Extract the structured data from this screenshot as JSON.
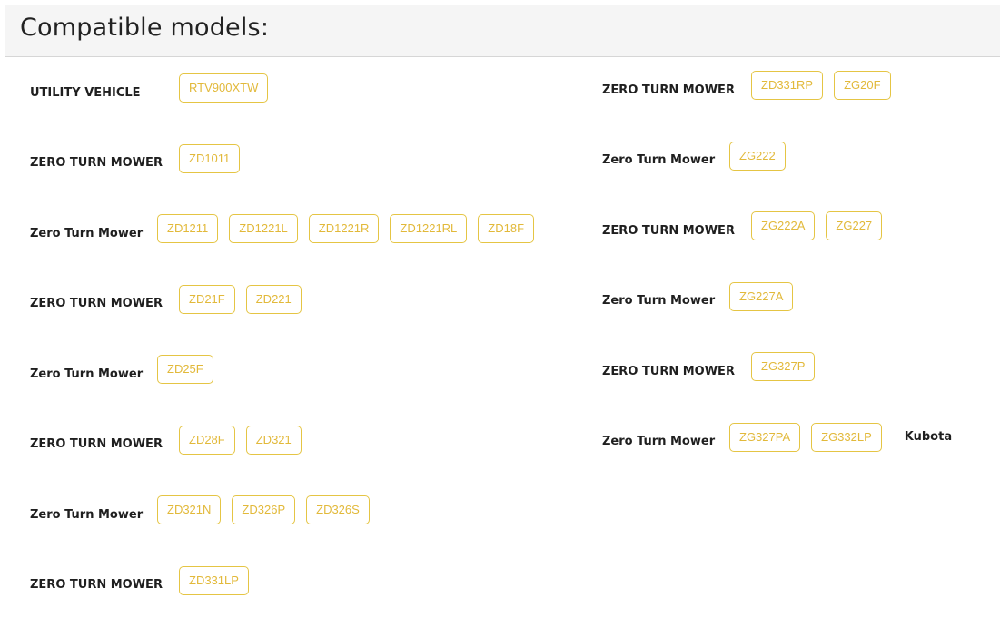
{
  "header": {
    "title": "Compatible models:"
  },
  "left": [
    {
      "label": "UTILITY VEHICLE",
      "models": [
        "RTV900XTW"
      ]
    },
    {
      "label": "ZERO TURN MOWER",
      "models": [
        "ZD1011"
      ]
    },
    {
      "label": "Zero Turn Mower",
      "models": [
        "ZD1211",
        "ZD1221L",
        "ZD1221R",
        "ZD1221RL",
        "ZD18F"
      ]
    },
    {
      "label": "ZERO TURN MOWER",
      "models": [
        "ZD21F",
        "ZD221"
      ]
    },
    {
      "label": "Zero Turn Mower",
      "models": [
        "ZD25F"
      ]
    },
    {
      "label": "ZERO TURN MOWER",
      "models": [
        "ZD28F",
        "ZD321"
      ]
    },
    {
      "label": "Zero Turn Mower",
      "models": [
        "ZD321N",
        "ZD326P",
        "ZD326S"
      ]
    },
    {
      "label": "ZERO TURN MOWER",
      "models": [
        "ZD331LP"
      ]
    }
  ],
  "right": [
    {
      "label": "ZERO TURN MOWER",
      "models": [
        "ZD331RP",
        "ZG20F"
      ]
    },
    {
      "label": "Zero Turn Mower",
      "models": [
        "ZG222"
      ]
    },
    {
      "label": "ZERO TURN MOWER",
      "models": [
        "ZG222A",
        "ZG227"
      ]
    },
    {
      "label": "Zero Turn Mower",
      "models": [
        "ZG227A"
      ]
    },
    {
      "label": "ZERO TURN MOWER",
      "models": [
        "ZG327P"
      ]
    },
    {
      "label": "Zero Turn Mower",
      "models": [
        "ZG327PA",
        "ZG332LP"
      ],
      "brand": "Kubota"
    }
  ]
}
